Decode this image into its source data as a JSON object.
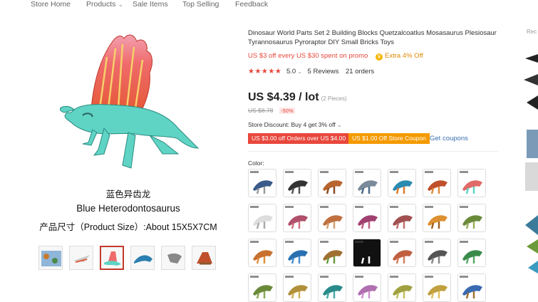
{
  "nav": {
    "items": [
      "Store Home",
      "Products",
      "Sale Items",
      "Top Selling",
      "Feedback"
    ]
  },
  "gallery": {
    "caption_cn": "蓝色异齿龙",
    "caption_en": "Blue Heterodontosaurus",
    "caption_size": "产品尺寸（Product Size）:About 15X5X7CM",
    "thumb_count": 6,
    "selected_thumb": 3
  },
  "product": {
    "title": "Dinosaur World Parts Set 2 Building Blocks Quetzalcoatlus Mosasaurus Plesiosaur Tyrannosaurus Pyroraptor DIY Small Bricks Toys",
    "promo": "US $3 off every US $30 spent on promo",
    "extra": "Extra 4% Off",
    "rating_value": "5.0",
    "rating_stars": 5,
    "reviews": "5 Reviews",
    "orders": "21 orders",
    "price": "US $4.39 / lot",
    "pieces": "(2 Pieces)",
    "original_price": "US $8.78",
    "discount": "-50%",
    "store_discount": "Store Discount: Buy 4 get 3% off",
    "coupon1": "US $3.00 off Orders over US $4.00",
    "coupon2": "US $1.00 Off Store Coupon",
    "get_coupons": "Get coupons",
    "color_label": "Color:"
  },
  "side": {
    "label": "Rec"
  },
  "colors": {
    "accent": "#e8473c",
    "orange": "#f59a00",
    "link": "#3a6fb0",
    "selected_border": "#c23a2b"
  }
}
